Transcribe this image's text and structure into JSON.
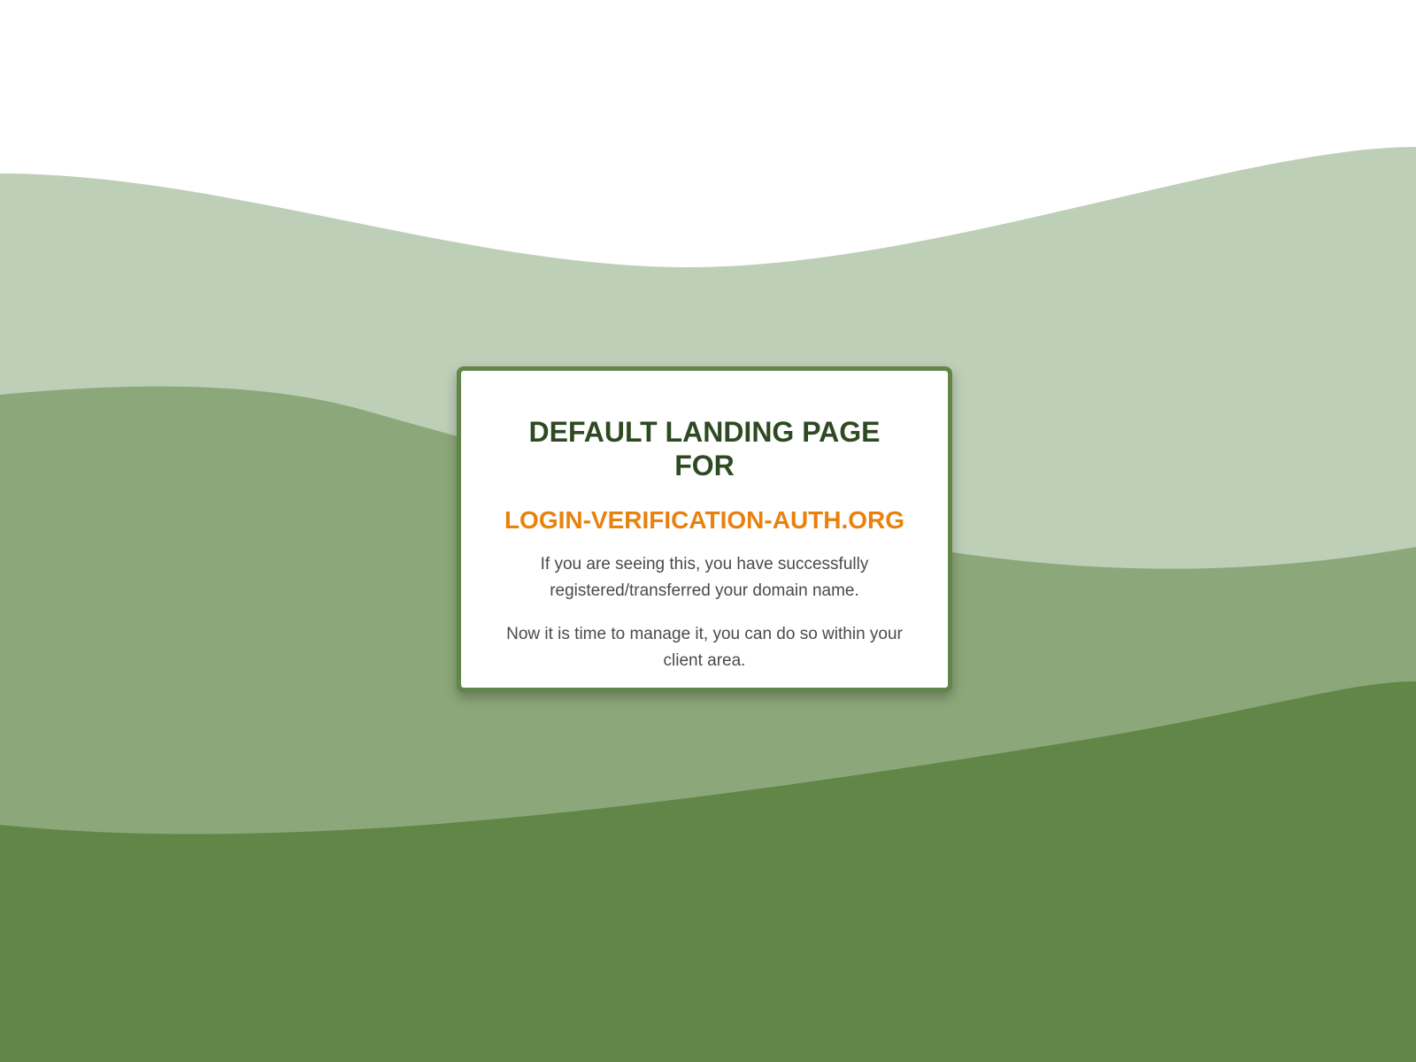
{
  "card": {
    "title": "DEFAULT LANDING PAGE FOR",
    "domain": "LOGIN-VERIFICATION-AUTH.ORG",
    "message_1": "If you are seeing this, you have successfully registered/transferred your domain name.",
    "message_2": "Now it is time to manage it, you can do so within your client area."
  },
  "colors": {
    "title": "#2e4a22",
    "domain_accent": "#e8820c",
    "card_border": "#628548",
    "wave_light": "#becfb7",
    "wave_mid": "#8ca87a",
    "wave_dark": "#628548"
  }
}
